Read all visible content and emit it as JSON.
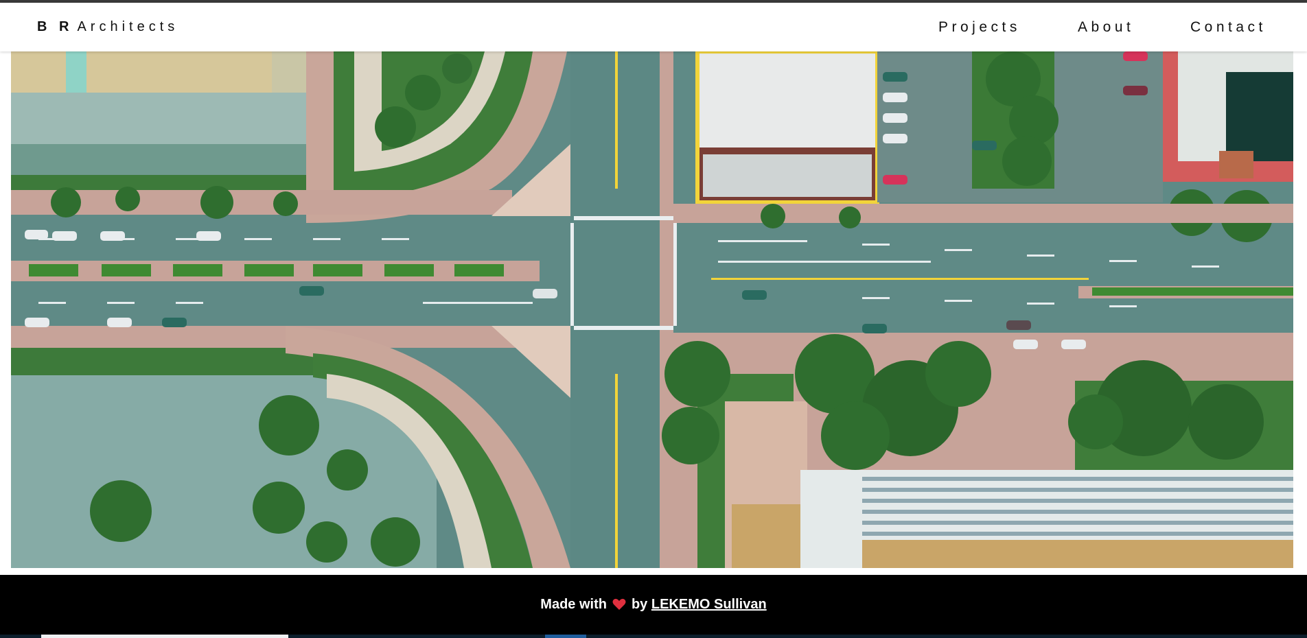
{
  "brand": {
    "bold": "B R",
    "rest": "Architects"
  },
  "nav": {
    "projects": "Projects",
    "about": "About",
    "contact": "Contact"
  },
  "footer": {
    "made_with": "Made with",
    "by": "by",
    "author": "LEKEMO Sullivan",
    "heart_color": "#e0303f"
  },
  "colors": {
    "navbar_bg": "#ffffff",
    "footer_bg": "#000000",
    "road": "#5f8a86",
    "grass": "#3f7d3a",
    "tree": "#2f6e2f",
    "marker_yellow": "#f2d43a"
  },
  "hero": {
    "alt": "aerial view of city intersection"
  }
}
